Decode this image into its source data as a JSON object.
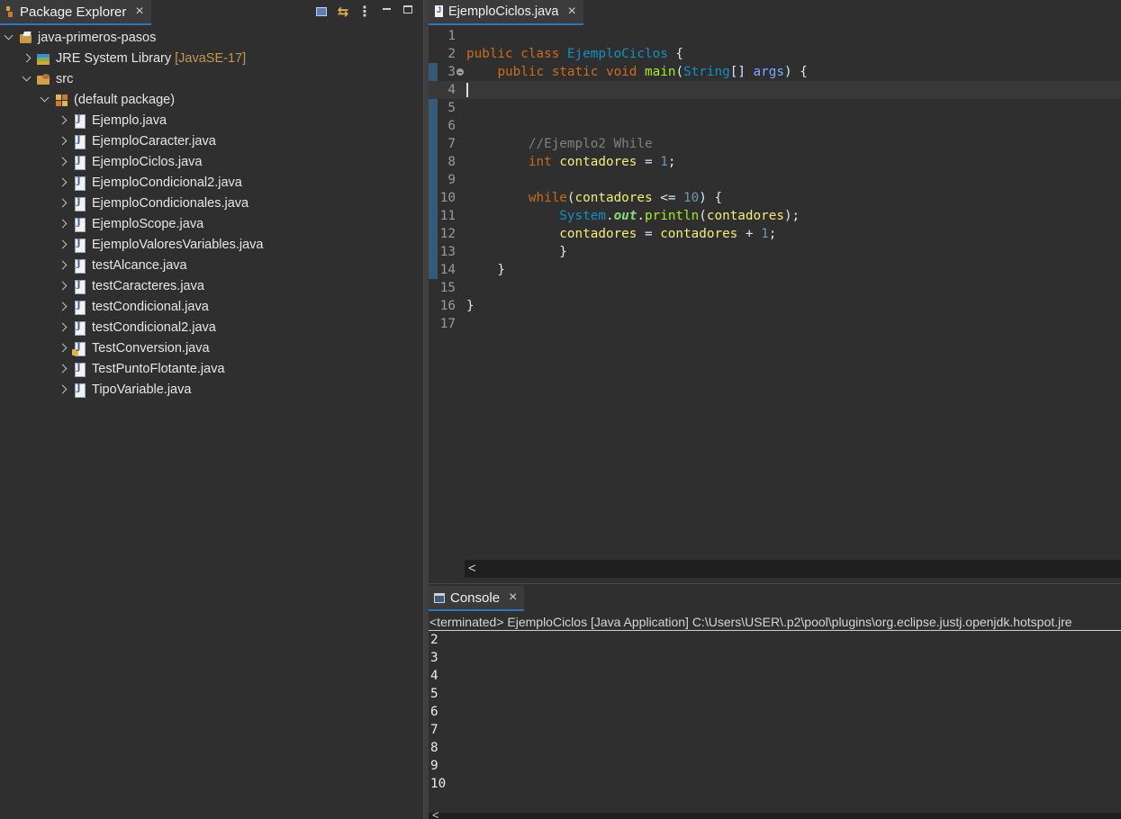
{
  "explorer": {
    "tab_label": "Package Explorer",
    "close_glyph": "×",
    "toolbar_icons": [
      "collapse-all-icon",
      "link-with-editor-icon",
      "view-menu-icon",
      "minimize-icon",
      "maximize-icon"
    ],
    "project": "java-primeros-pasos",
    "library": "JRE System Library",
    "library_version": "[JavaSE-17]",
    "src": "src",
    "package": "(default package)",
    "files": [
      {
        "name": "Ejemplo.java",
        "warning": false
      },
      {
        "name": "EjemploCaracter.java",
        "warning": false
      },
      {
        "name": "EjemploCiclos.java",
        "warning": false
      },
      {
        "name": "EjemploCondicional2.java",
        "warning": false
      },
      {
        "name": "EjemploCondicionales.java",
        "warning": false
      },
      {
        "name": "EjemploScope.java",
        "warning": false
      },
      {
        "name": "EjemploValoresVariables.java",
        "warning": false
      },
      {
        "name": "testAlcance.java",
        "warning": false
      },
      {
        "name": "testCaracteres.java",
        "warning": false
      },
      {
        "name": "testCondicional.java",
        "warning": false
      },
      {
        "name": "testCondicional2.java",
        "warning": false
      },
      {
        "name": "TestConversion.java",
        "warning": true
      },
      {
        "name": "TestPuntoFlotante.java",
        "warning": false
      },
      {
        "name": "TipoVariable.java",
        "warning": false
      }
    ]
  },
  "editor": {
    "tab_label": "EjemploCiclos.java",
    "close_glyph": "×",
    "current_line": 4,
    "scroll_left_glyph": "<",
    "lines": [
      {
        "n": "1",
        "tokens": []
      },
      {
        "n": "2",
        "tokens": [
          [
            "kw",
            "public"
          ],
          [
            "sy",
            " "
          ],
          [
            "kw",
            "class"
          ],
          [
            "sy",
            " "
          ],
          [
            "ty",
            "EjemploCiclos"
          ],
          [
            "sy",
            " {"
          ]
        ]
      },
      {
        "n": "3",
        "tokens": [
          [
            "sy",
            "    "
          ],
          [
            "kw",
            "public"
          ],
          [
            "sy",
            " "
          ],
          [
            "kw",
            "static"
          ],
          [
            "sy",
            " "
          ],
          [
            "kw",
            "void"
          ],
          [
            "sy",
            " "
          ],
          [
            "fn",
            "main"
          ],
          [
            "sy",
            "("
          ],
          [
            "ty",
            "String"
          ],
          [
            "sy",
            "[] "
          ],
          [
            "pm",
            "args"
          ],
          [
            "sy",
            ") {"
          ]
        ]
      },
      {
        "n": "4",
        "tokens": []
      },
      {
        "n": "5",
        "tokens": []
      },
      {
        "n": "6",
        "tokens": []
      },
      {
        "n": "7",
        "tokens": [
          [
            "sy",
            "        "
          ],
          [
            "cm",
            "//Ejemplo2 While"
          ]
        ]
      },
      {
        "n": "8",
        "tokens": [
          [
            "sy",
            "        "
          ],
          [
            "kw",
            "int"
          ],
          [
            "sy",
            " "
          ],
          [
            "vr",
            "contadores"
          ],
          [
            "sy",
            " = "
          ],
          [
            "nm",
            "1"
          ],
          [
            "sy",
            ";"
          ]
        ]
      },
      {
        "n": "9",
        "tokens": []
      },
      {
        "n": "10",
        "tokens": [
          [
            "sy",
            "        "
          ],
          [
            "kw",
            "while"
          ],
          [
            "sy",
            "("
          ],
          [
            "vr",
            "contadores"
          ],
          [
            "sy",
            " <= "
          ],
          [
            "nm",
            "10"
          ],
          [
            "sy",
            ") {"
          ]
        ]
      },
      {
        "n": "11",
        "tokens": [
          [
            "sy",
            "            "
          ],
          [
            "ty",
            "System"
          ],
          [
            "sy",
            "."
          ],
          [
            "fi",
            "out"
          ],
          [
            "sy",
            "."
          ],
          [
            "fn",
            "println"
          ],
          [
            "sy",
            "("
          ],
          [
            "vr",
            "contadores"
          ],
          [
            "sy",
            ");"
          ]
        ]
      },
      {
        "n": "12",
        "tokens": [
          [
            "sy",
            "            "
          ],
          [
            "vr",
            "contadores"
          ],
          [
            "sy",
            " = "
          ],
          [
            "vr",
            "contadores"
          ],
          [
            "sy",
            " + "
          ],
          [
            "nm",
            "1"
          ],
          [
            "sy",
            ";"
          ]
        ]
      },
      {
        "n": "13",
        "tokens": [
          [
            "sy",
            "            }"
          ]
        ]
      },
      {
        "n": "14",
        "tokens": [
          [
            "sy",
            "    }"
          ]
        ]
      },
      {
        "n": "15",
        "tokens": []
      },
      {
        "n": "16",
        "tokens": [
          [
            "sy",
            "}"
          ]
        ]
      },
      {
        "n": "17",
        "tokens": []
      }
    ]
  },
  "console": {
    "tab_label": "Console",
    "close_glyph": "×",
    "description": "<terminated> EjemploCiclos [Java Application] C:\\Users\\USER\\.p2\\pool\\plugins\\org.eclipse.justj.openjdk.hotspot.jre",
    "output": [
      "2",
      "3",
      "4",
      "5",
      "6",
      "7",
      "8",
      "9",
      "10"
    ],
    "scroll_left_glyph": "<"
  }
}
